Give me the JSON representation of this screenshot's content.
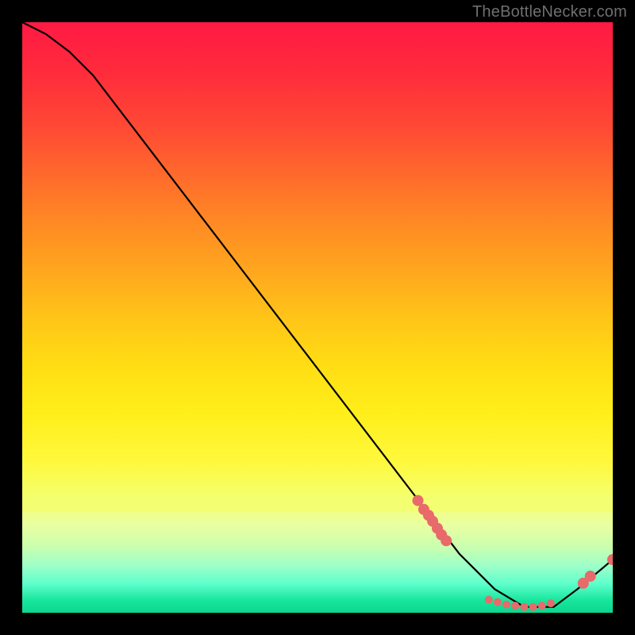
{
  "watermark": "TheBottleNecker.com",
  "chart_data": {
    "type": "line",
    "title": "",
    "xlabel": "",
    "ylabel": "",
    "xlim": [
      0,
      100
    ],
    "ylim": [
      0,
      100
    ],
    "series": [
      {
        "name": "bottleneck-curve",
        "x": [
          0,
          4,
          8,
          12,
          74,
          80,
          85,
          90,
          94,
          100
        ],
        "values": [
          100,
          98,
          95,
          91,
          10,
          4,
          1,
          1,
          4,
          9
        ]
      }
    ],
    "points": [
      {
        "name": "cluster-a",
        "x": 67,
        "y": 19
      },
      {
        "name": "cluster-a",
        "x": 68,
        "y": 17.5
      },
      {
        "name": "cluster-a",
        "x": 68.8,
        "y": 16.5
      },
      {
        "name": "cluster-a",
        "x": 69.5,
        "y": 15.5
      },
      {
        "name": "cluster-a",
        "x": 70.3,
        "y": 14.3
      },
      {
        "name": "cluster-a",
        "x": 71,
        "y": 13.2
      },
      {
        "name": "cluster-a",
        "x": 71.8,
        "y": 12.2
      },
      {
        "name": "flat-run",
        "x": 79,
        "y": 2.2
      },
      {
        "name": "flat-run",
        "x": 80.5,
        "y": 1.8
      },
      {
        "name": "flat-run",
        "x": 82,
        "y": 1.4
      },
      {
        "name": "flat-run",
        "x": 83.5,
        "y": 1.2
      },
      {
        "name": "flat-run",
        "x": 85,
        "y": 1.0
      },
      {
        "name": "flat-run",
        "x": 86.5,
        "y": 1.0
      },
      {
        "name": "flat-run",
        "x": 88,
        "y": 1.2
      },
      {
        "name": "flat-run",
        "x": 89.5,
        "y": 1.6
      },
      {
        "name": "tail",
        "x": 95,
        "y": 5
      },
      {
        "name": "tail",
        "x": 96.2,
        "y": 6.2
      },
      {
        "name": "tail",
        "x": 100,
        "y": 9
      }
    ],
    "gradient_stops": [
      {
        "pos": 0,
        "color": "#ff1a44"
      },
      {
        "pos": 50,
        "color": "#ffc418"
      },
      {
        "pos": 80,
        "color": "#f5ff6a"
      },
      {
        "pos": 100,
        "color": "#0dd68f"
      }
    ]
  }
}
